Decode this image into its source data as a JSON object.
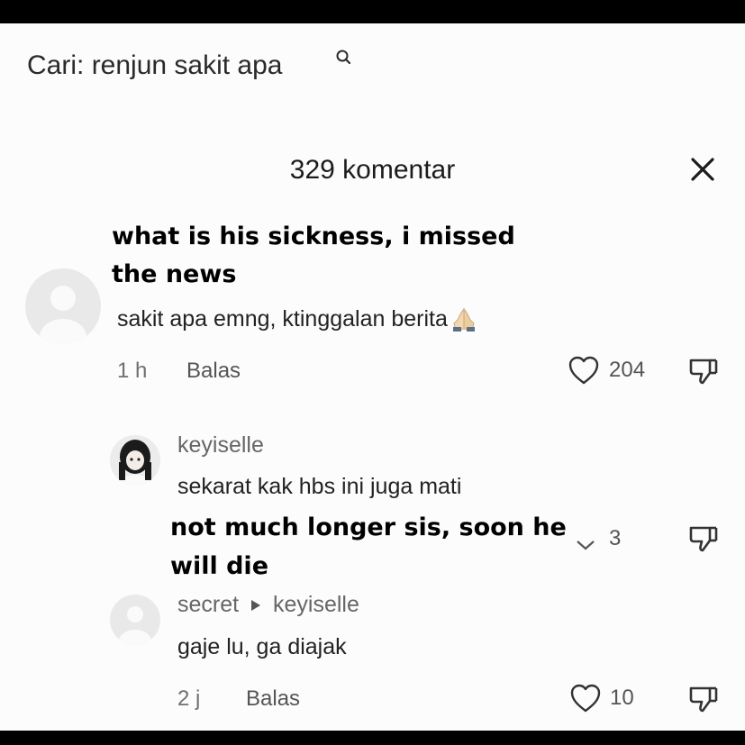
{
  "search": {
    "label": "Cari:",
    "query": "renjun sakit apa"
  },
  "header": {
    "title": "329 komentar"
  },
  "captions": {
    "first_line1": "what is his sickness, i missed",
    "first_line2": "the news",
    "second_line1": "not much longer sis, soon he",
    "second_line2": "will die"
  },
  "comments": [
    {
      "text": "sakit apa emng, ktinggalan berita",
      "emoji": "praying-hands",
      "time": "1 h",
      "reply_label": "Balas",
      "likes": "204"
    },
    {
      "username": "keyiselle",
      "text": "sekarat kak hbs ini juga mati",
      "likes": "3"
    },
    {
      "username": "secret",
      "reply_to": "keyiselle",
      "text": "gaje lu, ga diajak",
      "time": "2 j",
      "reply_label": "Balas",
      "likes": "10"
    }
  ],
  "colors": {
    "frame": "#000000",
    "background": "#fcfcfc",
    "text": "#222222",
    "meta": "#6f6f6f"
  }
}
